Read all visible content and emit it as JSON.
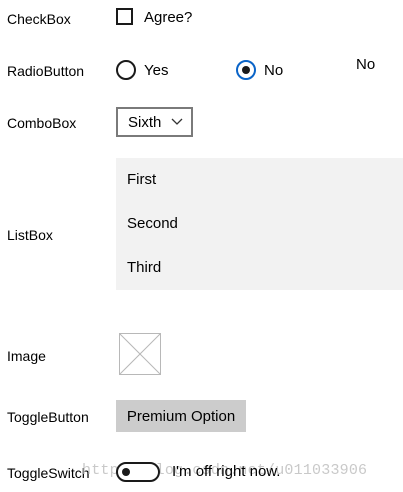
{
  "checkbox": {
    "row_label": "CheckBox",
    "text": "Agree?",
    "checked": false
  },
  "radio": {
    "row_label": "RadioButton",
    "options": [
      {
        "label": "Yes",
        "selected": false
      },
      {
        "label": "No",
        "selected": true
      }
    ],
    "selected_display": "No"
  },
  "combobox": {
    "row_label": "ComboBox",
    "selected_value": "Sixth"
  },
  "listbox": {
    "row_label": "ListBox",
    "items": [
      "First",
      "Second",
      "Third"
    ]
  },
  "image": {
    "row_label": "Image",
    "icon": "broken-image-placeholder-icon"
  },
  "toggle_button": {
    "row_label": "ToggleButton",
    "label": "Premium Option"
  },
  "toggle_switch": {
    "row_label": "ToggleSwitch",
    "status_text": "I'm off right now.",
    "on": false
  },
  "watermark": "http://blog.csdn.net/u011033906",
  "colors": {
    "accent": "#0a64c8",
    "list_bg": "#f2f2f2",
    "toggle_bg": "#cccccc"
  }
}
